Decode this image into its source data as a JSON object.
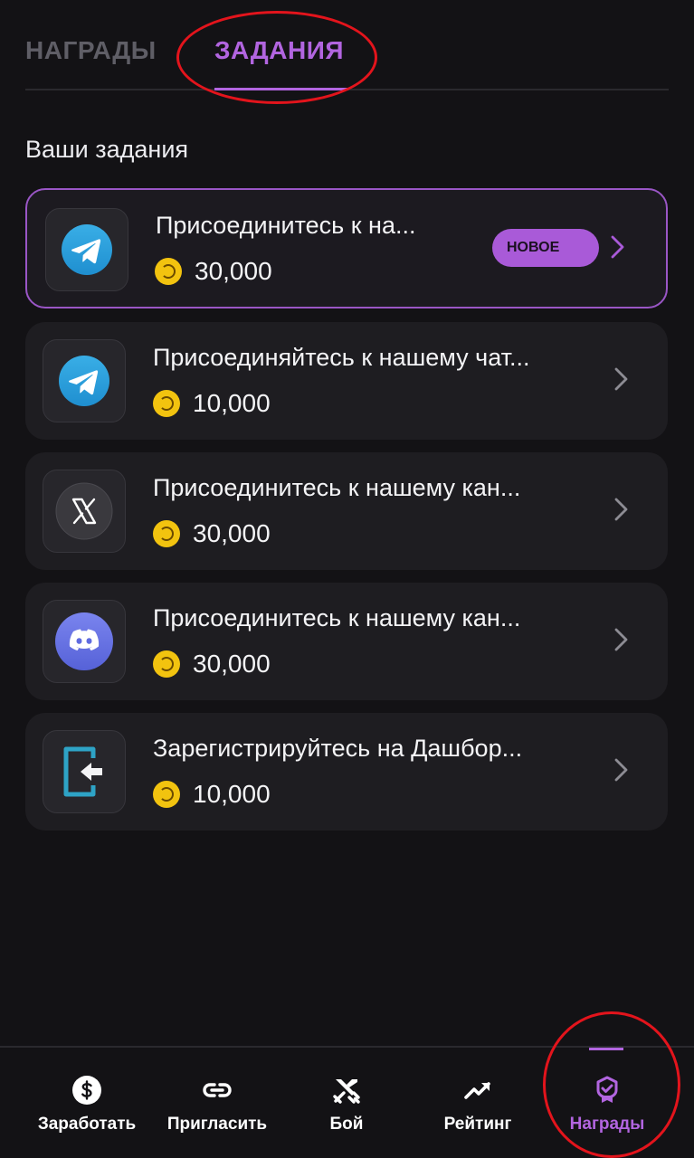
{
  "tabs": {
    "rewards_label": "НАГРАДЫ",
    "tasks_label": "ЗАДАНИЯ",
    "active": "tasks"
  },
  "section_title": "Ваши задания",
  "tasks": [
    {
      "title": "Присоединитесь к на...",
      "reward": "30,000",
      "badge": "НОВОЕ",
      "icon": "telegram-icon"
    },
    {
      "title": "Присоединяйтесь к нашему чат...",
      "reward": "10,000",
      "icon": "telegram-icon"
    },
    {
      "title": "Присоединитесь к нашему кан...",
      "reward": "30,000",
      "icon": "x-icon"
    },
    {
      "title": "Присоединитесь к нашему кан...",
      "reward": "30,000",
      "icon": "discord-icon"
    },
    {
      "title": "Зарегистрируйтесь на Дашбор...",
      "reward": "10,000",
      "icon": "login-icon"
    }
  ],
  "nav": {
    "earn_label": "Заработать",
    "invite_label": "Пригласить",
    "battle_label": "Бой",
    "rating_label": "Рейтинг",
    "rewards_label": "Награды",
    "active": "rewards"
  },
  "colors": {
    "accent": "#b265e0",
    "background": "#131215",
    "card": "#1e1d21",
    "coin": "#f2c30f",
    "annotation": "#e3141c"
  }
}
